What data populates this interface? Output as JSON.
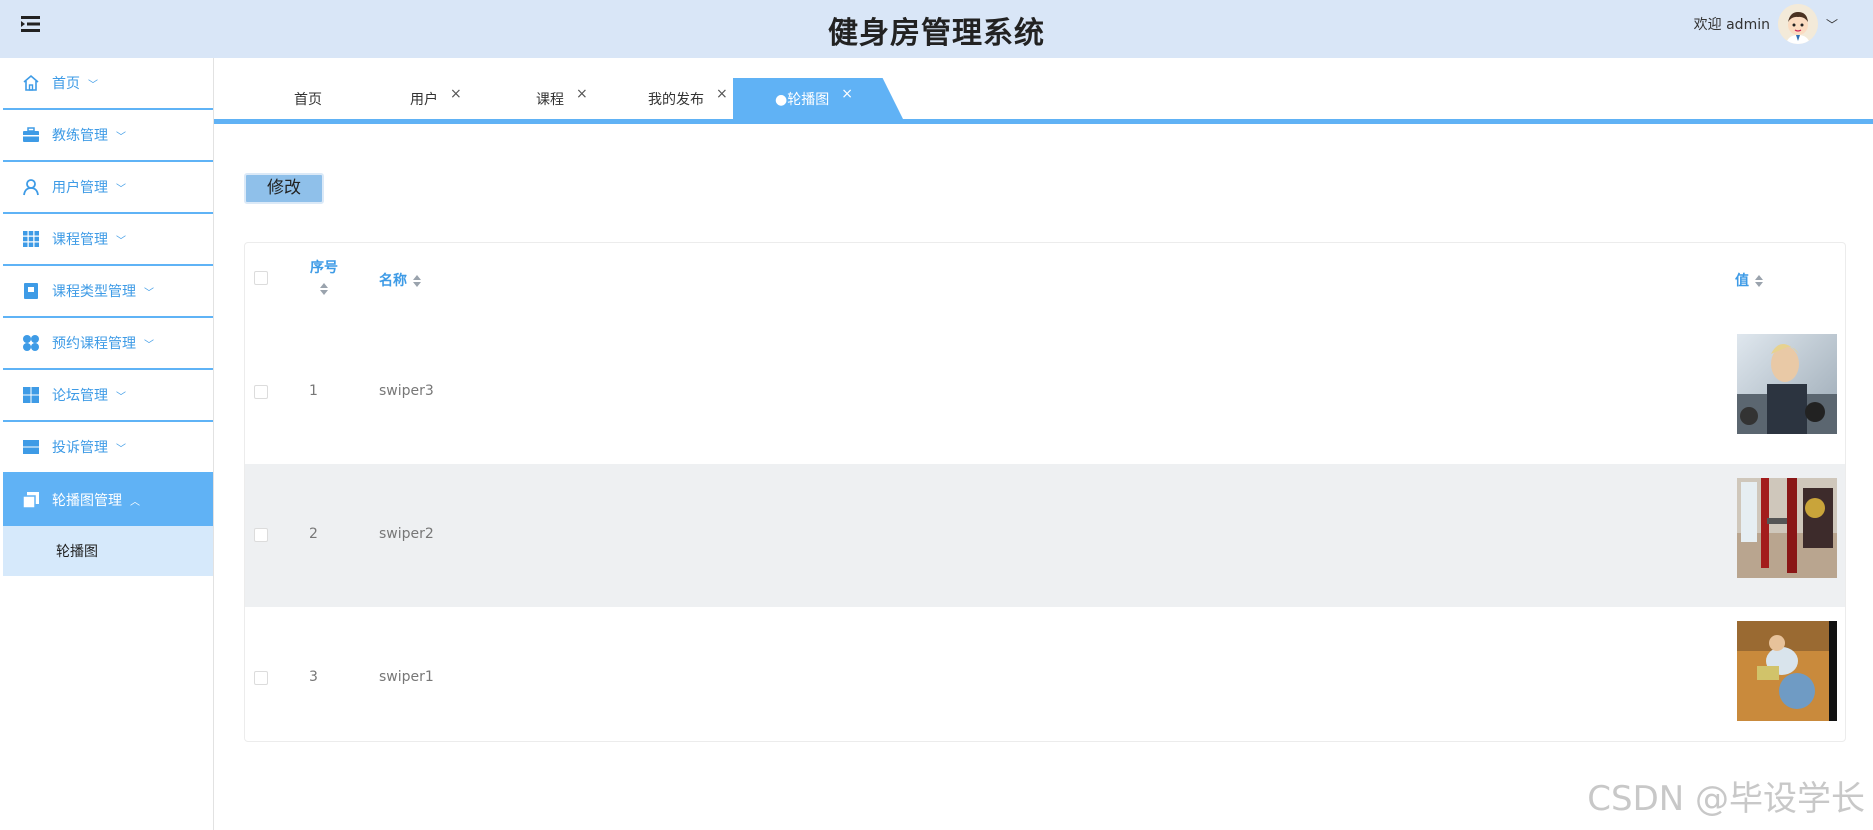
{
  "header": {
    "title": "健身房管理系统",
    "welcome": "欢迎 admin",
    "accent": "#60b2f5",
    "bg": "#d9e6f7"
  },
  "sidebar": {
    "items": [
      {
        "label": "首页",
        "icon": "home-icon"
      },
      {
        "label": "教练管理",
        "icon": "briefcase-icon"
      },
      {
        "label": "用户管理",
        "icon": "user-icon"
      },
      {
        "label": "课程管理",
        "icon": "grid-icon"
      },
      {
        "label": "课程类型管理",
        "icon": "book-icon"
      },
      {
        "label": "预约课程管理",
        "icon": "clover-icon"
      },
      {
        "label": "论坛管理",
        "icon": "layout-icon"
      },
      {
        "label": "投诉管理",
        "icon": "panel-icon"
      },
      {
        "label": "轮播图管理",
        "icon": "copy-icon"
      }
    ],
    "sub": "轮播图"
  },
  "tabs": [
    {
      "label": "首页"
    },
    {
      "label": "用户",
      "close": "×"
    },
    {
      "label": "课程",
      "close": "×"
    },
    {
      "label": "我的发布",
      "close": "×"
    },
    {
      "label": "●轮播图",
      "close": "×"
    }
  ],
  "toolbar": {
    "edit": "修改"
  },
  "table": {
    "headers": {
      "index": "序号",
      "name": "名称",
      "value": "值"
    },
    "rows": [
      {
        "index": "1",
        "name": "swiper3"
      },
      {
        "index": "2",
        "name": "swiper2"
      },
      {
        "index": "3",
        "name": "swiper1"
      }
    ]
  },
  "watermark": "CSDN @毕设学长"
}
